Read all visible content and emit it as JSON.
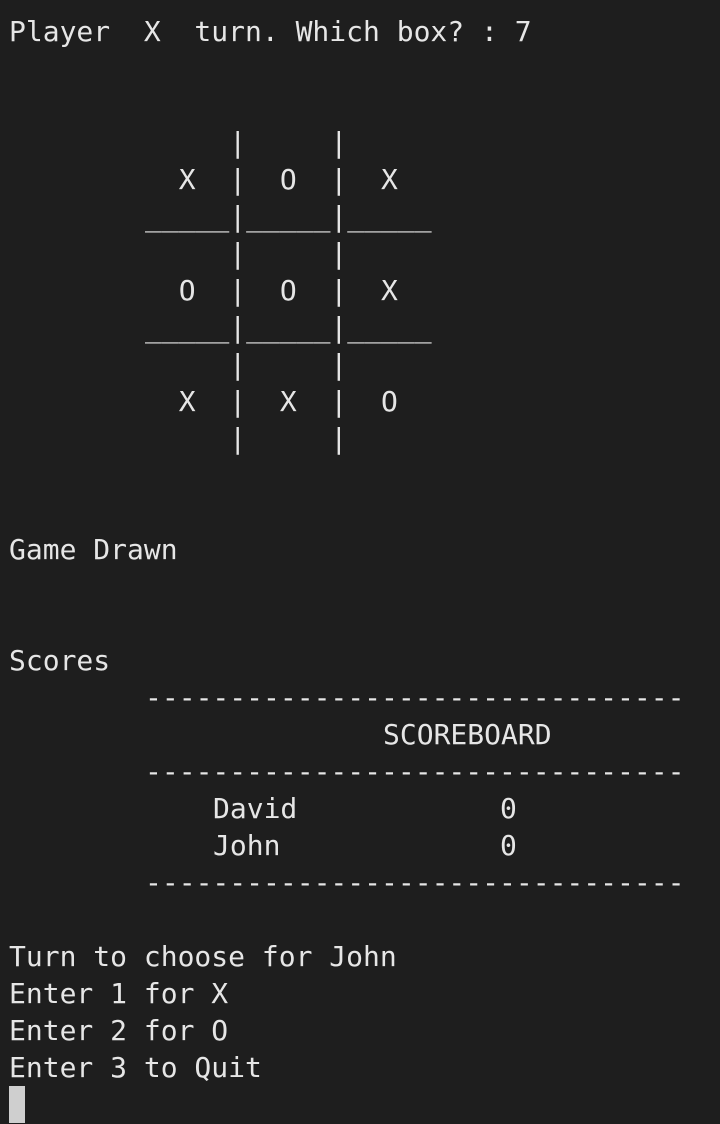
{
  "terminal": {
    "prompt_line": "Player  X  turn. Which box? : 7",
    "board_rows": [
      "     |     |     ",
      "  X  |  O  |  X  ",
      "_____|_____|_____",
      "     |     |     ",
      "  O  |  O  |  X  ",
      "_____|_____|_____",
      "     |     |     ",
      "  X  |  X  |  O  ",
      "     |     |     "
    ],
    "result": "Game Drawn",
    "scores_heading": "Scores",
    "scoreboard": {
      "separator": "--------------------------------",
      "title": "SCOREBOARD",
      "rows": [
        {
          "name": "David",
          "score": "0"
        },
        {
          "name": "John",
          "score": "0"
        }
      ]
    },
    "menu": {
      "prompt": "Turn to choose for John",
      "options": [
        "Enter 1 for X",
        "Enter 2 for O",
        "Enter 3 to Quit"
      ]
    }
  }
}
